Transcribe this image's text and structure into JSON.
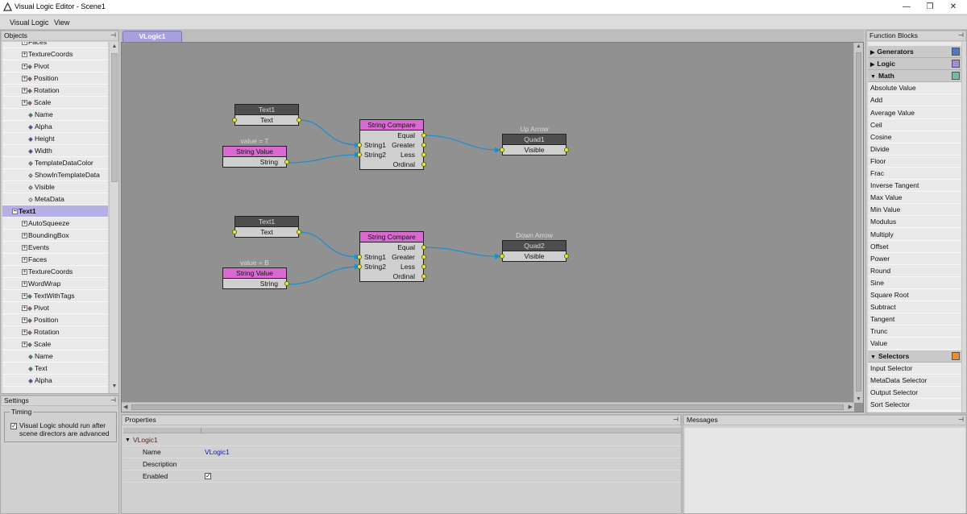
{
  "window": {
    "title": "Visual Logic Editor - Scene1",
    "minimize": "—",
    "restore": "❐",
    "close": "✕"
  },
  "menu": {
    "items": [
      "Visual Logic",
      "View"
    ]
  },
  "objects_panel": {
    "title": "Objects",
    "rows": [
      {
        "label": "Faces",
        "expand": "+",
        "dot": ""
      },
      {
        "label": "TextureCoords",
        "expand": "+",
        "dot": ""
      },
      {
        "label": "Pivot",
        "expand": "+",
        "dot": "#b04fb0"
      },
      {
        "label": "Position",
        "expand": "+",
        "dot": "#b04fb0"
      },
      {
        "label": "Rotation",
        "expand": "+",
        "dot": "#b04fb0"
      },
      {
        "label": "Scale",
        "expand": "+",
        "dot": "#b04fb0"
      },
      {
        "label": "Name",
        "expand": "",
        "dot": "#2c9a7a"
      },
      {
        "label": "Alpha",
        "expand": "",
        "dot": "#3f3fc9"
      },
      {
        "label": "Height",
        "expand": "",
        "dot": "#3f3fc9"
      },
      {
        "label": "Width",
        "expand": "",
        "dot": "#3f3fc9"
      },
      {
        "label": "TemplateDataColor",
        "expand": "",
        "dot": "#6aa6d6"
      },
      {
        "label": "ShowInTemplateData",
        "expand": "",
        "dot": "#a8d070"
      },
      {
        "label": "Visible",
        "expand": "",
        "dot": "#a8d070"
      },
      {
        "label": "MetaData",
        "expand": "",
        "dot": "#ffffff"
      },
      {
        "label": "Text1",
        "expand": "−",
        "dot": "",
        "selected": true,
        "level": 0
      },
      {
        "label": "AutoSqueeze",
        "expand": "+",
        "dot": ""
      },
      {
        "label": "BoundingBox",
        "expand": "+",
        "dot": ""
      },
      {
        "label": "Events",
        "expand": "+",
        "dot": ""
      },
      {
        "label": "Faces",
        "expand": "+",
        "dot": ""
      },
      {
        "label": "TextureCoords",
        "expand": "+",
        "dot": ""
      },
      {
        "label": "WordWrap",
        "expand": "+",
        "dot": ""
      },
      {
        "label": "TextWithTags",
        "expand": "+",
        "dot": "#2c9a7a"
      },
      {
        "label": "Pivot",
        "expand": "+",
        "dot": "#b04fb0"
      },
      {
        "label": "Position",
        "expand": "+",
        "dot": "#b04fb0"
      },
      {
        "label": "Rotation",
        "expand": "+",
        "dot": "#b04fb0"
      },
      {
        "label": "Scale",
        "expand": "+",
        "dot": "#b04fb0"
      },
      {
        "label": "Name",
        "expand": "",
        "dot": "#2c9a7a"
      },
      {
        "label": "Text",
        "expand": "",
        "dot": "#2c9a7a"
      },
      {
        "label": "Alpha",
        "expand": "",
        "dot": "#3f3fc9"
      }
    ]
  },
  "settings_panel": {
    "title": "Settings",
    "group": "Timing",
    "checkbox_line1": "Visual Logic should run after",
    "checkbox_line2": "scene directors are advanced",
    "checked_mark": "✓"
  },
  "canvas": {
    "tab": "VLogic1",
    "nodes": {
      "text_a": {
        "header": "Text1",
        "row": "Text"
      },
      "sv_a": {
        "caption": "value = T",
        "header": "String Value",
        "row": "String"
      },
      "cmp_a": {
        "header": "String Compare",
        "in1": "String1",
        "in2": "String2",
        "out_equal": "Equal",
        "out_greater": "Greater",
        "out_less": "Less",
        "out_ordinal": "Ordinal"
      },
      "quad_a": {
        "caption": "Up Arrow",
        "header": "Quad1",
        "row": "Visible"
      },
      "text_b": {
        "header": "Text1",
        "row": "Text"
      },
      "sv_b": {
        "caption": "value = B",
        "header": "String Value",
        "row": "String"
      },
      "cmp_b": {
        "header": "String Compare",
        "in1": "String1",
        "in2": "String2",
        "out_equal": "Equal",
        "out_greater": "Greater",
        "out_less": "Less",
        "out_ordinal": "Ordinal"
      },
      "quad_b": {
        "caption": "Down Arrow",
        "header": "Quad2",
        "row": "Visible"
      }
    }
  },
  "function_blocks": {
    "title": "Function Blocks",
    "rows": [
      {
        "label": "Generators",
        "category": true,
        "arrow": "▶",
        "color": "#4f78c0"
      },
      {
        "label": "Logic",
        "category": true,
        "arrow": "▶",
        "color": "#9b90d6"
      },
      {
        "label": "Math",
        "category": true,
        "arrow": "▼",
        "color": "#6bbfa8"
      },
      {
        "label": "Absolute Value"
      },
      {
        "label": "Add"
      },
      {
        "label": "Average Value"
      },
      {
        "label": "Ceil"
      },
      {
        "label": "Cosine"
      },
      {
        "label": "Divide"
      },
      {
        "label": "Floor"
      },
      {
        "label": "Frac"
      },
      {
        "label": "Inverse Tangent"
      },
      {
        "label": "Max Value"
      },
      {
        "label": "Min Value"
      },
      {
        "label": "Modulus"
      },
      {
        "label": "Multiply"
      },
      {
        "label": "Offset"
      },
      {
        "label": "Power"
      },
      {
        "label": "Round"
      },
      {
        "label": "Sine"
      },
      {
        "label": "Square Root"
      },
      {
        "label": "Subtract"
      },
      {
        "label": "Tangent"
      },
      {
        "label": "Trunc"
      },
      {
        "label": "Value"
      },
      {
        "label": "Selectors",
        "category": true,
        "arrow": "▼",
        "color": "#e8902c"
      },
      {
        "label": "Input Selector"
      },
      {
        "label": "MetaData Selector"
      },
      {
        "label": "Output Selector"
      },
      {
        "label": "Sort Selector"
      }
    ]
  },
  "properties_panel": {
    "title": "Properties",
    "group": "VLogic1",
    "name_label": "Name",
    "name_value": "VLogic1",
    "description_label": "Description",
    "enabled_label": "Enabled",
    "enabled_mark": "✓"
  },
  "messages_panel": {
    "title": "Messages"
  },
  "pin_glyph": "⊣",
  "colors": {
    "selection": "#b6b0e6",
    "tab": "#a6a0dc",
    "node_pink": "#d96ad1",
    "node_dark": "#4e4e4e",
    "wire": "#1a8fd0",
    "port": "#e8e838"
  }
}
